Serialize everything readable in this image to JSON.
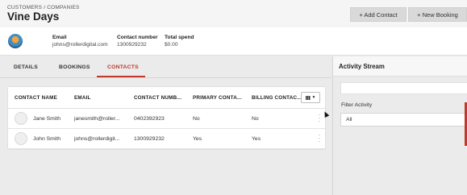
{
  "header": {
    "breadcrumb": "CUSTOMERS / COMPANIES",
    "title": "Vine Days",
    "add_contact_label": "+ Add Contact",
    "new_booking_label": "+ New Booking"
  },
  "summary": {
    "email_label": "Email",
    "email_value": "johns@rollerdigital.com",
    "contact_label": "Contact number",
    "contact_value": "1300929232",
    "spend_label": "Total spend",
    "spend_value": "$0.00"
  },
  "tabs": [
    {
      "label": "DETAILS"
    },
    {
      "label": "BOOKINGS"
    },
    {
      "label": "CONTACTS"
    }
  ],
  "table": {
    "columns": [
      "CONTACT NAME",
      "EMAIL",
      "CONTACT NUMB...",
      "PRIMARY CONTA...",
      "BILLING CONTAC..."
    ],
    "rows": [
      {
        "name": "Jane Smith",
        "email": "janesmith@roller...",
        "number": "0402392923",
        "primary": "No",
        "billing": "No"
      },
      {
        "name": "John Smith",
        "email": "johns@rollerdigit...",
        "number": "1300929232",
        "primary": "Yes",
        "billing": "Yes"
      }
    ]
  },
  "activity": {
    "title": "Activity Stream",
    "filter_label": "Filter Activity",
    "filter_value": "All"
  },
  "colors": {
    "accent": "#c0392b"
  }
}
